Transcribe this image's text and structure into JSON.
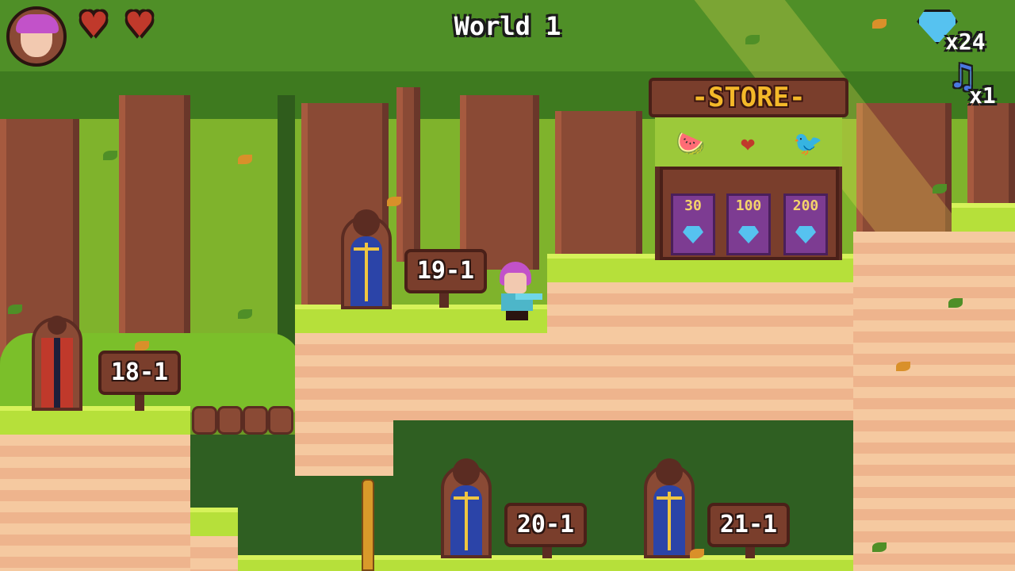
{
  "hud": {
    "world_title": "World 1",
    "hearts": [
      "♥",
      "♥"
    ],
    "gem_count": "x24",
    "note_count": "x1",
    "portrait": "player-portrait",
    "gem_icon": "diamond-gem-icon",
    "note_icon": "music-note-icon",
    "note_glyph": "♫"
  },
  "store": {
    "title": "-STORE-",
    "items": [
      {
        "icon": "watermelon-icon",
        "glyph": "🍉",
        "price": "30"
      },
      {
        "icon": "heart-potion-icon",
        "glyph": "❤",
        "price": "100"
      },
      {
        "icon": "bird-companion-icon",
        "glyph": "🐦",
        "price": "200"
      }
    ]
  },
  "levels": [
    {
      "label": "18-1",
      "state": "open"
    },
    {
      "label": "19-1",
      "state": "closed"
    },
    {
      "label": "20-1",
      "state": "closed"
    },
    {
      "label": "21-1",
      "state": "closed"
    }
  ],
  "colors": {
    "grass": "#b6e03a",
    "dirt": "#f5c9a0",
    "door_blue": "#2b44a8",
    "sign_wood": "#7a3e2c",
    "gem": "#56c2f0",
    "store_title": "#f4b829"
  }
}
